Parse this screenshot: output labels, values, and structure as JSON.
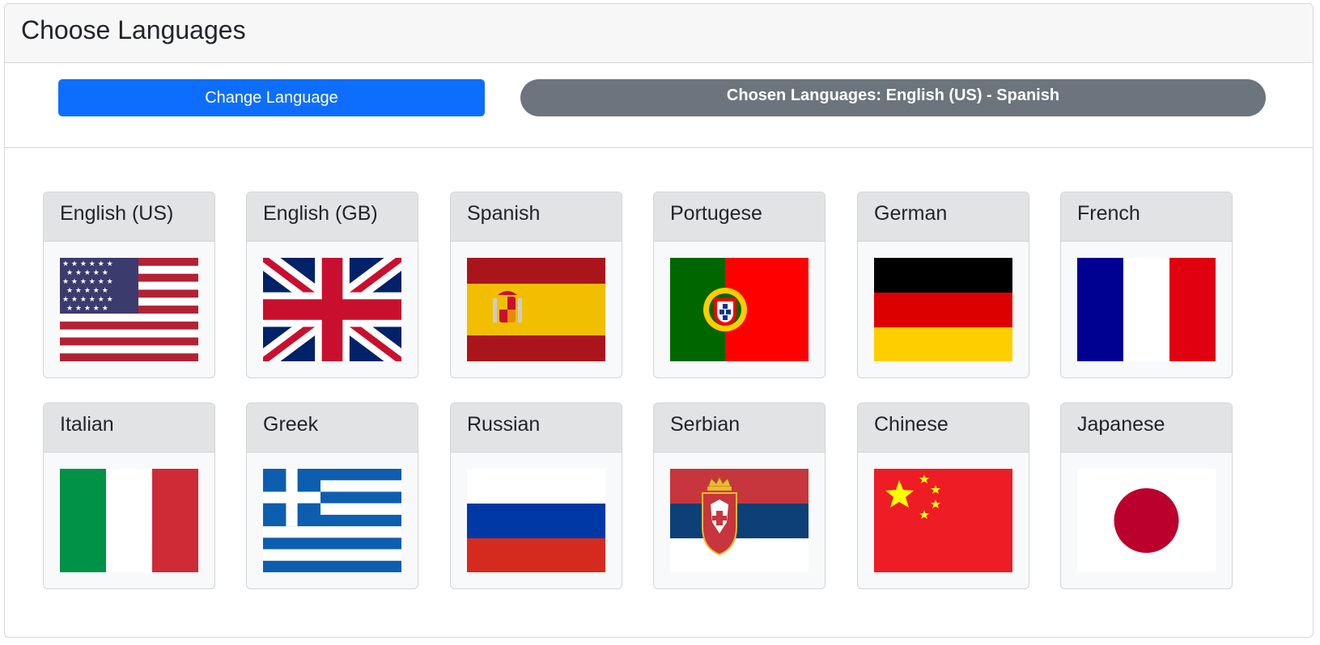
{
  "header": {
    "title": "Choose Languages"
  },
  "toolbar": {
    "change_button_label": "Change Language",
    "chosen_label": "Chosen Languages: English (US) - Spanish"
  },
  "colors": {
    "primary": "#0d6efd",
    "secondary": "#6c757d",
    "card_header": "#e2e3e5",
    "card_body": "#f8f9fa"
  },
  "languages": [
    {
      "name": "English (US)",
      "flag": "usa-flag-icon"
    },
    {
      "name": "English (GB)",
      "flag": "uk-flag-icon"
    },
    {
      "name": "Spanish",
      "flag": "spain-flag-icon"
    },
    {
      "name": "Portugese",
      "flag": "portugal-flag-icon"
    },
    {
      "name": "German",
      "flag": "germany-flag-icon"
    },
    {
      "name": "French",
      "flag": "france-flag-icon"
    },
    {
      "name": "Italian",
      "flag": "italy-flag-icon"
    },
    {
      "name": "Greek",
      "flag": "greece-flag-icon"
    },
    {
      "name": "Russian",
      "flag": "russia-flag-icon"
    },
    {
      "name": "Serbian",
      "flag": "serbia-flag-icon"
    },
    {
      "name": "Chinese",
      "flag": "china-flag-icon"
    },
    {
      "name": "Japanese",
      "flag": "japan-flag-icon"
    }
  ]
}
